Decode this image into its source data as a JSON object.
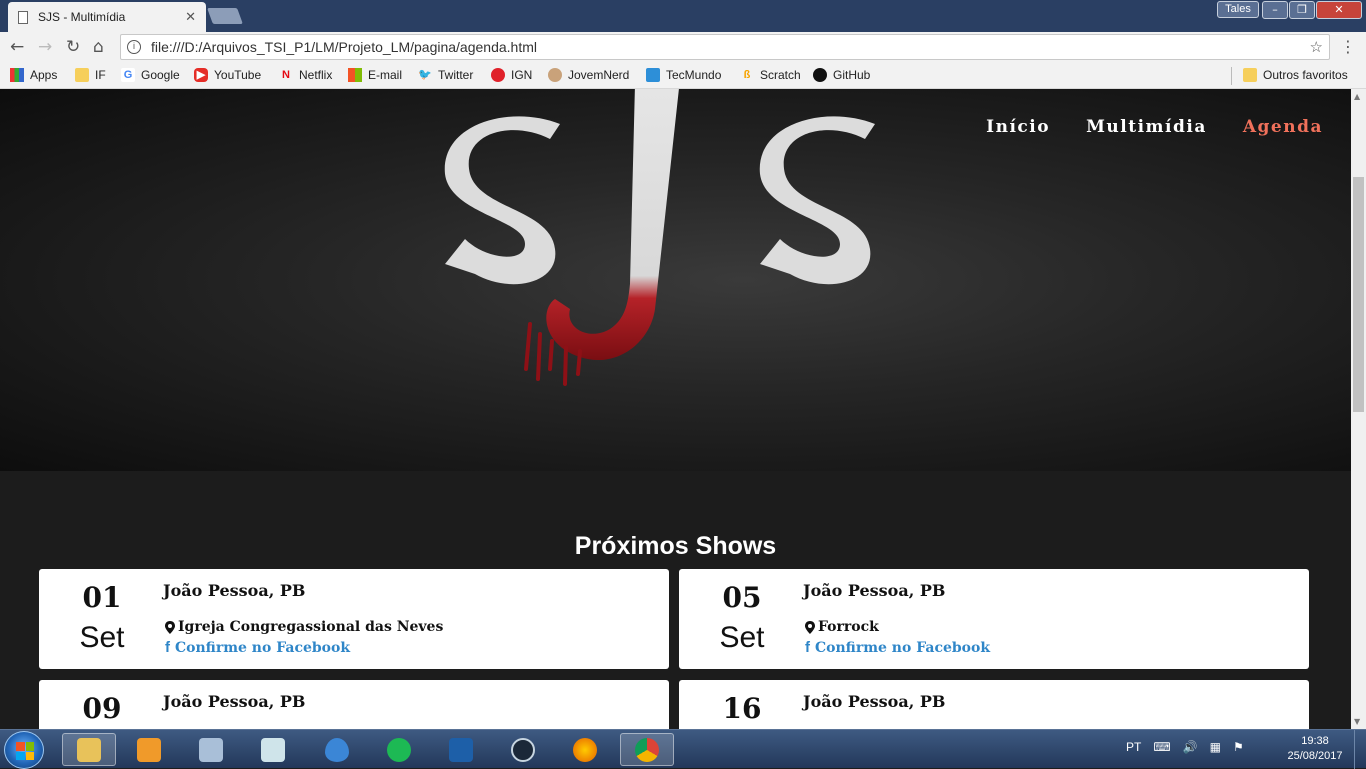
{
  "browser": {
    "tab_title": "SJS - Multimídia",
    "tab_close": "✕",
    "profile_name": "Tales",
    "url": "file:///D:/Arquivos_TSI_P1/LM/Projeto_LM/pagina/agenda.html",
    "bookmarks": [
      {
        "label": "Apps",
        "icon": "apps-grid-icon"
      },
      {
        "label": "IF",
        "icon": "folder-icon"
      },
      {
        "label": "Google",
        "icon": "google-icon"
      },
      {
        "label": "YouTube",
        "icon": "youtube-icon"
      },
      {
        "label": "Netflix",
        "icon": "netflix-icon"
      },
      {
        "label": "E-mail",
        "icon": "windows-icon"
      },
      {
        "label": "Twitter",
        "icon": "twitter-icon"
      },
      {
        "label": "IGN",
        "icon": "ign-icon"
      },
      {
        "label": "JovemNerd",
        "icon": "jovemnerd-icon"
      },
      {
        "label": "TecMundo",
        "icon": "tecmundo-icon"
      },
      {
        "label": "Scratch",
        "icon": "scratch-icon"
      },
      {
        "label": "GitHub",
        "icon": "github-icon"
      }
    ],
    "other_bookmarks": "Outros favoritos"
  },
  "site": {
    "nav": [
      {
        "label": "Início",
        "active": false
      },
      {
        "label": "Multimídia",
        "active": false
      },
      {
        "label": "Agenda",
        "active": true
      }
    ],
    "accent_color": "#f0715b",
    "link_color": "#2f86c8",
    "section_title": "Próximos Shows",
    "shows": [
      {
        "day": "01",
        "month": "Set",
        "city": "João Pessoa, PB",
        "venue": "Igreja Congregassional das Neves",
        "facebook": "Confirme no Facebook"
      },
      {
        "day": "05",
        "month": "Set",
        "city": "João Pessoa, PB",
        "venue": "Forrock",
        "facebook": "Confirme no Facebook"
      },
      {
        "day": "09",
        "city": "João Pessoa, PB"
      },
      {
        "day": "16",
        "city": "João Pessoa, PB"
      }
    ]
  },
  "taskbar": {
    "language": "PT",
    "time": "19:38",
    "date": "25/08/2017"
  }
}
